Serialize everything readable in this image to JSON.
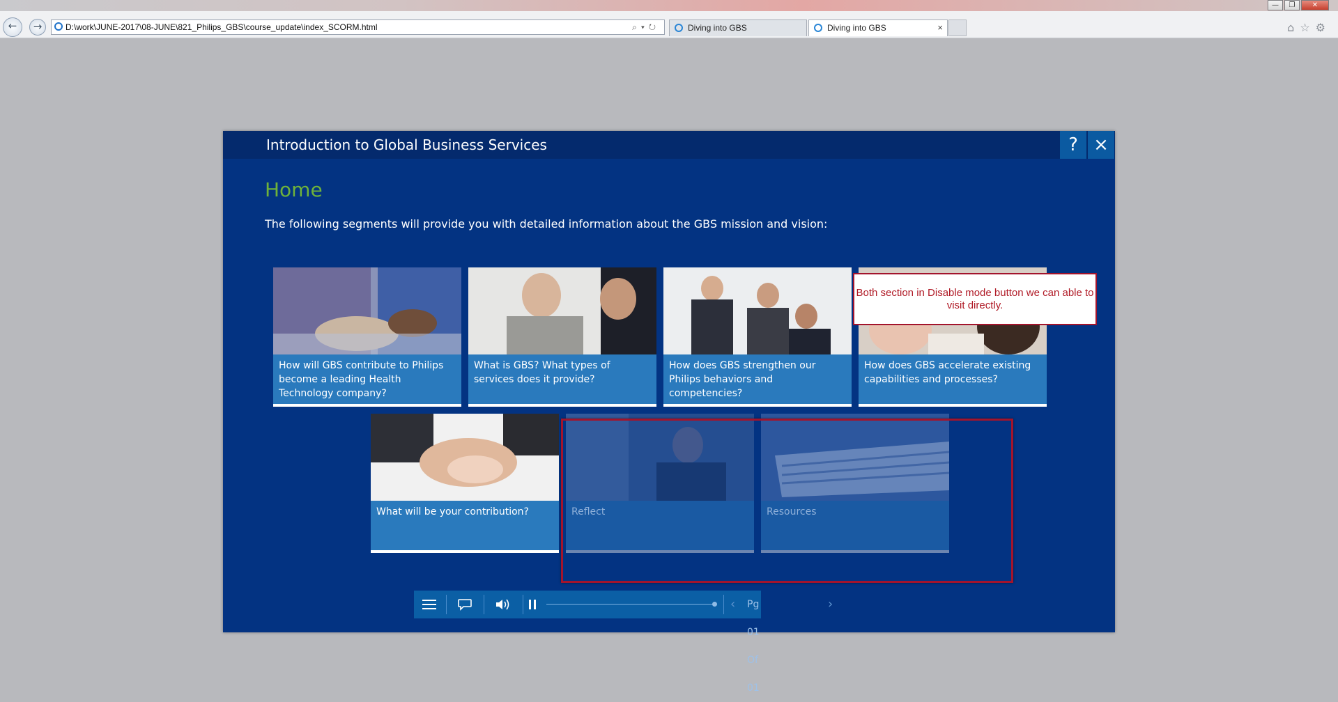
{
  "browser": {
    "address": "D:\\work\\JUNE-2017\\08-JUNE\\821_Philips_GBS\\course_update\\index_SCORM.html",
    "tabs": [
      {
        "label": "Diving into GBS",
        "active": false
      },
      {
        "label": "Diving into GBS",
        "active": true
      }
    ],
    "tab_close": "×",
    "window_controls": {
      "minimize": "—",
      "maximize": "❐",
      "close": "✕"
    }
  },
  "course": {
    "title": "Introduction to Global Business Services",
    "help_label": "?",
    "close_label": "×",
    "page_heading": "Home",
    "intro": "The following segments will provide you with detailed information about the GBS mission and vision:",
    "tiles": [
      {
        "label": "How will GBS contribute to Philips become a leading Health Technology company?",
        "disabled": false
      },
      {
        "label": "What is GBS? What types of services does it provide?",
        "disabled": false
      },
      {
        "label": "How does GBS strengthen our Philips behaviors and competencies?",
        "disabled": false
      },
      {
        "label": "How does GBS accelerate existing capabilities and processes?",
        "disabled": false
      },
      {
        "label": "What will be your contribution?",
        "disabled": false
      },
      {
        "label": "Reflect",
        "disabled": true
      },
      {
        "label": "Resources",
        "disabled": true
      }
    ]
  },
  "annotation": {
    "text": "Both section in Disable mode button we can able to visit directly."
  },
  "player": {
    "page_indicator": "Pg 01 Of 01",
    "menu_icon": "hamburger-menu-icon",
    "transcript_icon": "speech-bubble-icon",
    "audio_icon": "speaker-icon",
    "pause_icon": "pause-icon"
  },
  "colors": {
    "course_bg": "#033382",
    "header_bg": "#042a6d",
    "accent_green": "#6fb23a",
    "tile_caption": "#2a7abd",
    "annotation_red": "#a3142c"
  }
}
